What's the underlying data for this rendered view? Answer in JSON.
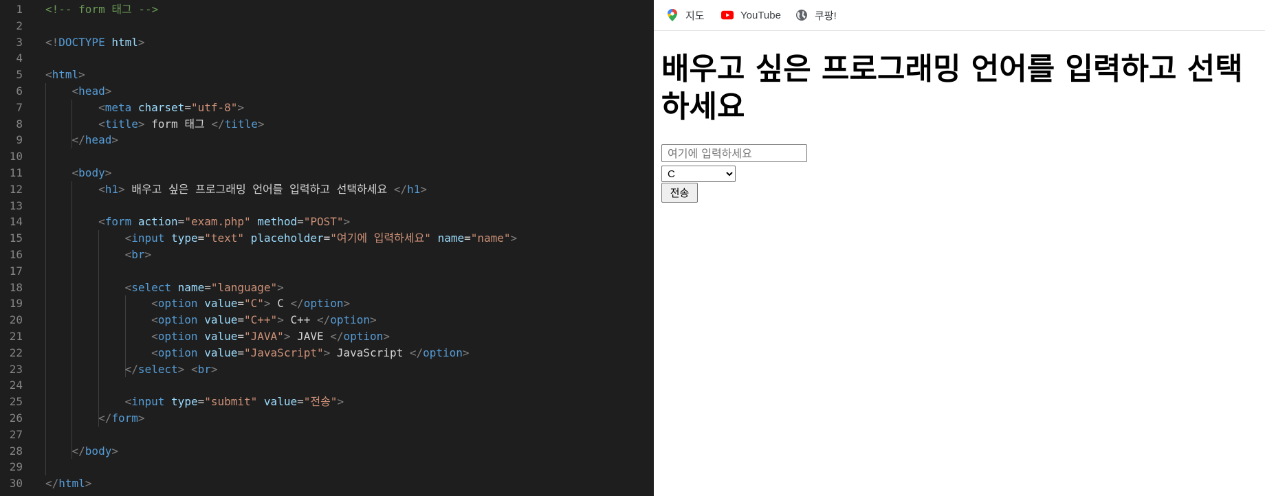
{
  "editor": {
    "lines": [
      [
        [
          "t-com",
          "<!-- form 태그 -->"
        ]
      ],
      [],
      [
        [
          "t-punc",
          "<!"
        ],
        [
          "t-tag",
          "DOCTYPE"
        ],
        [
          "t-text",
          " "
        ],
        [
          "t-attr",
          "html"
        ],
        [
          "t-punc",
          ">"
        ]
      ],
      [],
      [
        [
          "t-punc",
          "<"
        ],
        [
          "t-tag",
          "html"
        ],
        [
          "t-punc",
          ">"
        ]
      ],
      [
        [
          "t-text",
          "    "
        ],
        [
          "t-punc",
          "<"
        ],
        [
          "t-tag",
          "head"
        ],
        [
          "t-punc",
          ">"
        ]
      ],
      [
        [
          "t-text",
          "        "
        ],
        [
          "t-punc",
          "<"
        ],
        [
          "t-tag",
          "meta"
        ],
        [
          "t-text",
          " "
        ],
        [
          "t-attr",
          "charset"
        ],
        [
          "t-text",
          "="
        ],
        [
          "t-str",
          "\"utf-8\""
        ],
        [
          "t-punc",
          ">"
        ]
      ],
      [
        [
          "t-text",
          "        "
        ],
        [
          "t-punc",
          "<"
        ],
        [
          "t-tag",
          "title"
        ],
        [
          "t-punc",
          ">"
        ],
        [
          "t-text",
          " form 태그 "
        ],
        [
          "t-punc",
          "</"
        ],
        [
          "t-tag",
          "title"
        ],
        [
          "t-punc",
          ">"
        ]
      ],
      [
        [
          "t-text",
          "    "
        ],
        [
          "t-punc",
          "</"
        ],
        [
          "t-tag",
          "head"
        ],
        [
          "t-punc",
          ">"
        ]
      ],
      [],
      [
        [
          "t-text",
          "    "
        ],
        [
          "t-punc",
          "<"
        ],
        [
          "t-tag",
          "body"
        ],
        [
          "t-punc",
          ">"
        ]
      ],
      [
        [
          "t-text",
          "        "
        ],
        [
          "t-punc",
          "<"
        ],
        [
          "t-tag",
          "h1"
        ],
        [
          "t-punc",
          ">"
        ],
        [
          "t-text",
          " 배우고 싶은 프로그래밍 언어를 입력하고 선택하세요 "
        ],
        [
          "t-punc",
          "</"
        ],
        [
          "t-tag",
          "h1"
        ],
        [
          "t-punc",
          ">"
        ]
      ],
      [],
      [
        [
          "t-text",
          "        "
        ],
        [
          "t-punc",
          "<"
        ],
        [
          "t-tag",
          "form"
        ],
        [
          "t-text",
          " "
        ],
        [
          "t-attr",
          "action"
        ],
        [
          "t-text",
          "="
        ],
        [
          "t-str",
          "\"exam.php\""
        ],
        [
          "t-text",
          " "
        ],
        [
          "t-attr",
          "method"
        ],
        [
          "t-text",
          "="
        ],
        [
          "t-str",
          "\"POST\""
        ],
        [
          "t-punc",
          ">"
        ]
      ],
      [
        [
          "t-text",
          "            "
        ],
        [
          "t-punc",
          "<"
        ],
        [
          "t-tag",
          "input"
        ],
        [
          "t-text",
          " "
        ],
        [
          "t-attr",
          "type"
        ],
        [
          "t-text",
          "="
        ],
        [
          "t-str",
          "\"text\""
        ],
        [
          "t-text",
          " "
        ],
        [
          "t-attr",
          "placeholder"
        ],
        [
          "t-text",
          "="
        ],
        [
          "t-str",
          "\"여기에 입력하세요\""
        ],
        [
          "t-text",
          " "
        ],
        [
          "t-attr",
          "name"
        ],
        [
          "t-text",
          "="
        ],
        [
          "t-str",
          "\"name\""
        ],
        [
          "t-punc",
          ">"
        ]
      ],
      [
        [
          "t-text",
          "            "
        ],
        [
          "t-punc",
          "<"
        ],
        [
          "t-tag",
          "br"
        ],
        [
          "t-punc",
          ">"
        ]
      ],
      [],
      [
        [
          "t-text",
          "            "
        ],
        [
          "t-punc",
          "<"
        ],
        [
          "t-tag",
          "select"
        ],
        [
          "t-text",
          " "
        ],
        [
          "t-attr",
          "name"
        ],
        [
          "t-text",
          "="
        ],
        [
          "t-str",
          "\"language\""
        ],
        [
          "t-punc",
          ">"
        ]
      ],
      [
        [
          "t-text",
          "                "
        ],
        [
          "t-punc",
          "<"
        ],
        [
          "t-tag",
          "option"
        ],
        [
          "t-text",
          " "
        ],
        [
          "t-attr",
          "value"
        ],
        [
          "t-text",
          "="
        ],
        [
          "t-str",
          "\"C\""
        ],
        [
          "t-punc",
          ">"
        ],
        [
          "t-text",
          " C "
        ],
        [
          "t-punc",
          "</"
        ],
        [
          "t-tag",
          "option"
        ],
        [
          "t-punc",
          ">"
        ]
      ],
      [
        [
          "t-text",
          "                "
        ],
        [
          "t-punc",
          "<"
        ],
        [
          "t-tag",
          "option"
        ],
        [
          "t-text",
          " "
        ],
        [
          "t-attr",
          "value"
        ],
        [
          "t-text",
          "="
        ],
        [
          "t-str",
          "\"C++\""
        ],
        [
          "t-punc",
          ">"
        ],
        [
          "t-text",
          " C++ "
        ],
        [
          "t-punc",
          "</"
        ],
        [
          "t-tag",
          "option"
        ],
        [
          "t-punc",
          ">"
        ]
      ],
      [
        [
          "t-text",
          "                "
        ],
        [
          "t-punc",
          "<"
        ],
        [
          "t-tag",
          "option"
        ],
        [
          "t-text",
          " "
        ],
        [
          "t-attr",
          "value"
        ],
        [
          "t-text",
          "="
        ],
        [
          "t-str",
          "\"JAVA\""
        ],
        [
          "t-punc",
          ">"
        ],
        [
          "t-text",
          " JAVE "
        ],
        [
          "t-punc",
          "</"
        ],
        [
          "t-tag",
          "option"
        ],
        [
          "t-punc",
          ">"
        ]
      ],
      [
        [
          "t-text",
          "                "
        ],
        [
          "t-punc",
          "<"
        ],
        [
          "t-tag",
          "option"
        ],
        [
          "t-text",
          " "
        ],
        [
          "t-attr",
          "value"
        ],
        [
          "t-text",
          "="
        ],
        [
          "t-str",
          "\"JavaScript\""
        ],
        [
          "t-punc",
          ">"
        ],
        [
          "t-text",
          " JavaScript "
        ],
        [
          "t-punc",
          "</"
        ],
        [
          "t-tag",
          "option"
        ],
        [
          "t-punc",
          ">"
        ]
      ],
      [
        [
          "t-text",
          "            "
        ],
        [
          "t-punc",
          "</"
        ],
        [
          "t-tag",
          "select"
        ],
        [
          "t-punc",
          ">"
        ],
        [
          "t-text",
          " "
        ],
        [
          "t-punc",
          "<"
        ],
        [
          "t-tag",
          "br"
        ],
        [
          "t-punc",
          ">"
        ]
      ],
      [],
      [
        [
          "t-text",
          "            "
        ],
        [
          "t-punc",
          "<"
        ],
        [
          "t-tag",
          "input"
        ],
        [
          "t-text",
          " "
        ],
        [
          "t-attr",
          "type"
        ],
        [
          "t-text",
          "="
        ],
        [
          "t-str",
          "\"submit\""
        ],
        [
          "t-text",
          " "
        ],
        [
          "t-attr",
          "value"
        ],
        [
          "t-text",
          "="
        ],
        [
          "t-str",
          "\"전송\""
        ],
        [
          "t-punc",
          ">"
        ]
      ],
      [
        [
          "t-text",
          "        "
        ],
        [
          "t-punc",
          "</"
        ],
        [
          "t-tag",
          "form"
        ],
        [
          "t-punc",
          ">"
        ]
      ],
      [],
      [
        [
          "t-text",
          "    "
        ],
        [
          "t-punc",
          "</"
        ],
        [
          "t-tag",
          "body"
        ],
        [
          "t-punc",
          ">"
        ]
      ],
      [],
      [
        [
          "t-punc",
          "</"
        ],
        [
          "t-tag",
          "html"
        ],
        [
          "t-punc",
          ">"
        ]
      ]
    ]
  },
  "browser": {
    "bookmarks": [
      {
        "label": "지도",
        "icon": "maps-pin-icon"
      },
      {
        "label": "YouTube",
        "icon": "youtube-icon"
      },
      {
        "label": "쿠팡!",
        "icon": "globe-icon"
      }
    ],
    "heading": "배우고 싶은 프로그래밍 언어를 입력하고 선택하세요",
    "form": {
      "input_placeholder": "여기에 입력하세요",
      "input_value": "",
      "select_options": [
        "C",
        "C++",
        "JAVE",
        "JavaScript"
      ],
      "selected_option": "C",
      "submit_label": "전송"
    }
  },
  "colors": {
    "editor_bg": "#1e1e1e",
    "line_number": "#858585",
    "tag": "#569cd6",
    "attribute": "#9cdcfe",
    "string": "#ce9178",
    "comment": "#6a9955",
    "punctuation": "#808080",
    "text": "#d4d4d4"
  }
}
